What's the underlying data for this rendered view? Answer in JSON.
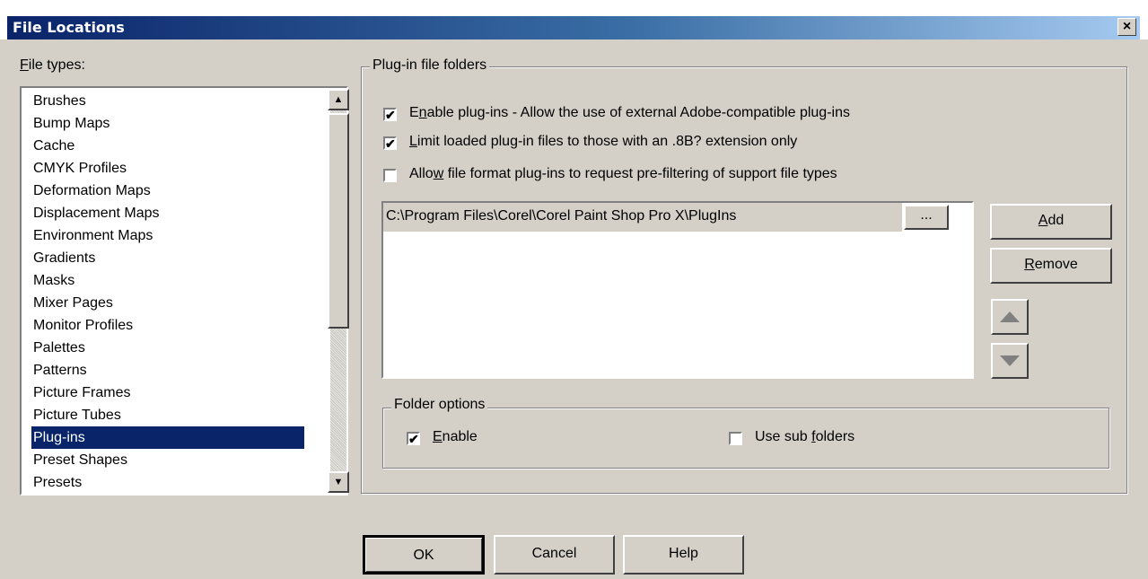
{
  "window": {
    "title": "File Locations",
    "close_label": "×"
  },
  "file_types": {
    "label": "File types:",
    "items": [
      "Brushes",
      "Bump Maps",
      "Cache",
      "CMYK Profiles",
      "Deformation Maps",
      "Displacement Maps",
      "Environment Maps",
      "Gradients",
      "Masks",
      "Mixer Pages",
      "Monitor Profiles",
      "Palettes",
      "Patterns",
      "Picture Frames",
      "Picture Tubes",
      "Plug-ins",
      "Preset Shapes",
      "Presets"
    ],
    "selected": "Plug-ins"
  },
  "plugin_group": {
    "title": "Plug-in file folders",
    "options": [
      {
        "label": "Enable plug-ins - Allow the use of external Adobe-compatible plug-ins",
        "checked": true
      },
      {
        "label": "Limit loaded plug-in files to those with an .8B? extension only",
        "checked": true
      },
      {
        "label": "Allow file format plug-ins to request pre-filtering of support file types",
        "checked": false
      }
    ],
    "folder_path": "C:\\Program Files\\Corel\\Corel Paint Shop Pro X\\PlugIns",
    "browse_label": "...",
    "add_label": "Add",
    "remove_label": "Remove"
  },
  "folder_options": {
    "title": "Folder options",
    "enable_label": "Enable",
    "enable_checked": true,
    "subfolders_label": "Use sub folders",
    "subfolders_checked": false
  },
  "buttons": {
    "ok": "OK",
    "cancel": "Cancel",
    "help": "Help"
  }
}
